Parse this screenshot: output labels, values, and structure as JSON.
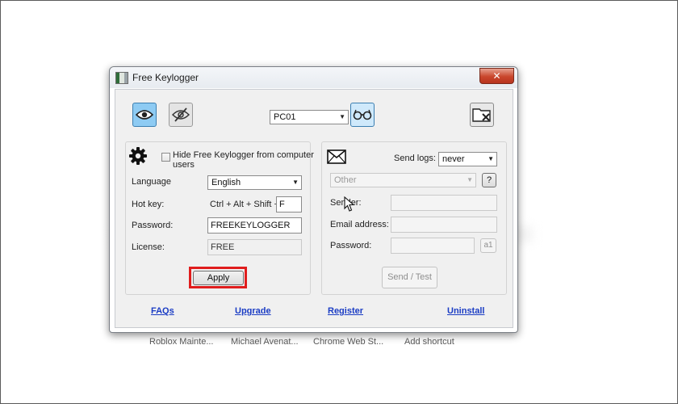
{
  "window": {
    "title": "Free Keylogger",
    "close_label": "✕"
  },
  "toolbar": {
    "computer_select": "PC01"
  },
  "settings": {
    "hide_label_line1": "Hide Free Keylogger from computer",
    "hide_label_line2": "users",
    "hide_checked": false,
    "language_label": "Language",
    "language_value": "English",
    "hotkey_label": "Hot key:",
    "hotkey_combo": "Ctrl + Alt + Shift +",
    "hotkey_key": "F",
    "password_label": "Password:",
    "password_value": "FREEKEYLOGGER",
    "license_label": "License:",
    "license_value": "FREE",
    "apply_label": "Apply"
  },
  "email": {
    "send_logs_label": "Send logs:",
    "send_logs_value": "never",
    "provider_value": "Other",
    "help_label": "?",
    "sender_label": "Sender:",
    "email_label": "Email address:",
    "password_label": "Password:",
    "reveal_label": "a1",
    "send_test_label": "Send / Test"
  },
  "links": {
    "faqs": "FAQs",
    "upgrade": "Upgrade",
    "register": "Register",
    "uninstall": "Uninstall"
  },
  "background_tiles": [
    "Roblox Mainte...",
    "Michael Avenat...",
    "Chrome Web St...",
    "Add shortcut"
  ],
  "colors": {
    "accent_red": "#e01d1d",
    "link_blue": "#1a3cc4",
    "active_tool": "#8ecbf3"
  }
}
